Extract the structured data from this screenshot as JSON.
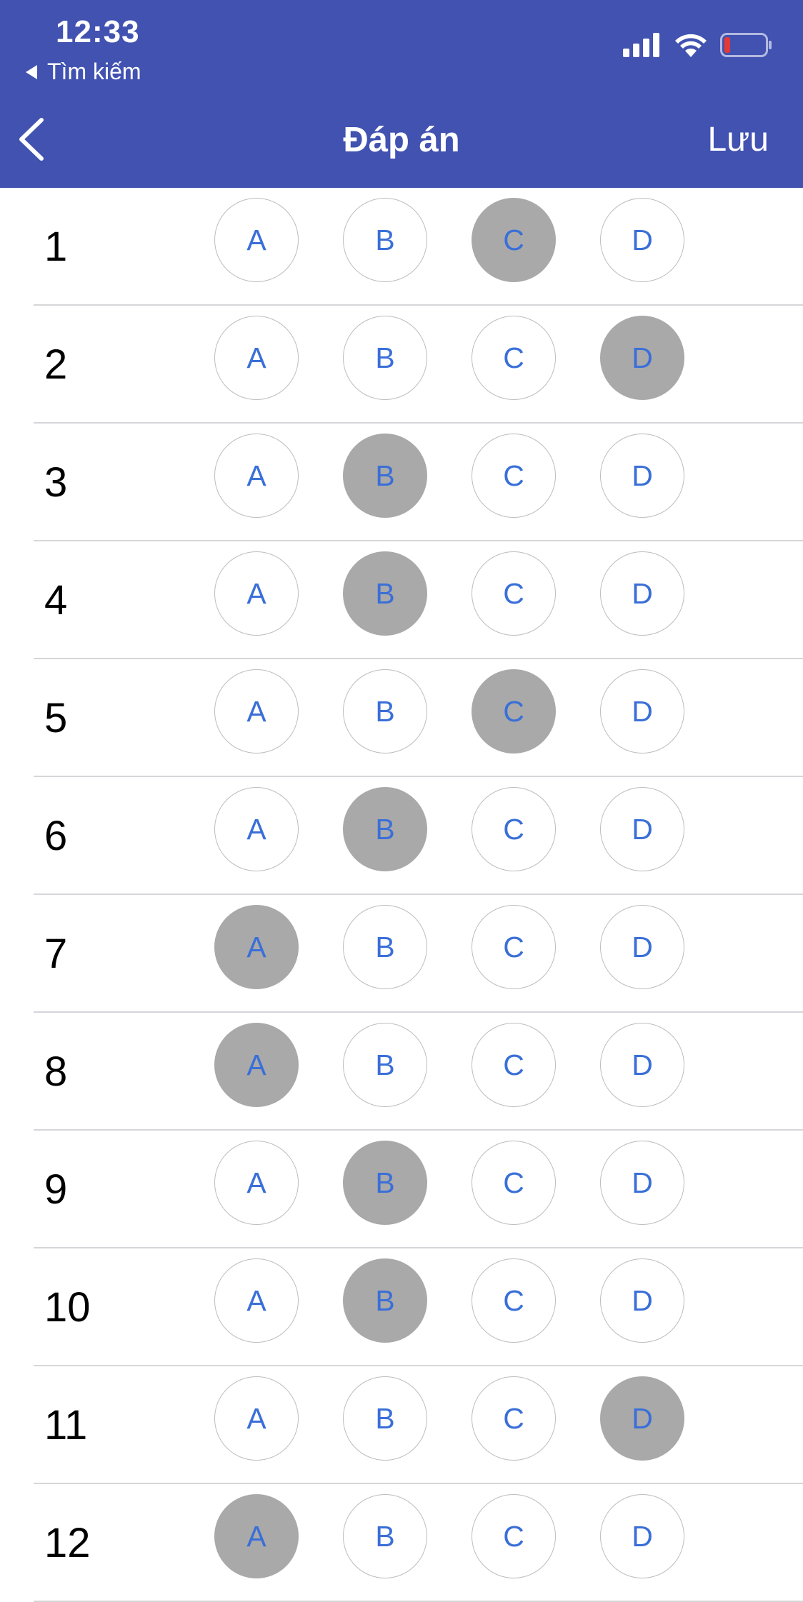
{
  "status_bar": {
    "time": "12:33",
    "back_app_label": "Tìm kiếm",
    "battery_level": 0.15
  },
  "nav": {
    "title": "Đáp án",
    "save_label": "Lưu"
  },
  "options": [
    "A",
    "B",
    "C",
    "D"
  ],
  "questions": [
    {
      "number": "1",
      "selected": "C"
    },
    {
      "number": "2",
      "selected": "D"
    },
    {
      "number": "3",
      "selected": "B"
    },
    {
      "number": "4",
      "selected": "B"
    },
    {
      "number": "5",
      "selected": "C"
    },
    {
      "number": "6",
      "selected": "B"
    },
    {
      "number": "7",
      "selected": "A"
    },
    {
      "number": "8",
      "selected": "A"
    },
    {
      "number": "9",
      "selected": "B"
    },
    {
      "number": "10",
      "selected": "B"
    },
    {
      "number": "11",
      "selected": "D"
    },
    {
      "number": "12",
      "selected": "A"
    }
  ],
  "colors": {
    "header_bg": "#4152b1",
    "option_text": "#3a6fd8",
    "selected_bg": "#a9a9a9",
    "battery_low": "#e53935"
  }
}
